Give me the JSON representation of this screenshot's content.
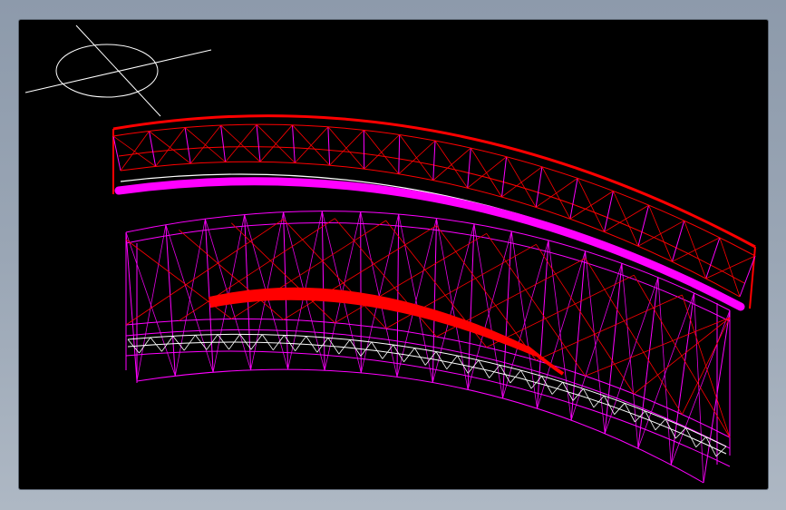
{
  "viewport": {
    "background": "#000000",
    "frame_background": "#9aa6b5"
  },
  "model": {
    "render_mode": "wireframe",
    "colors": {
      "edge_primary": "#ff00ff",
      "edge_secondary": "#ff0000",
      "edge_hidden": "#ffffff"
    }
  },
  "ucs_icon": {
    "name": "coordinate-axes-icon",
    "color": "#ffffff"
  }
}
